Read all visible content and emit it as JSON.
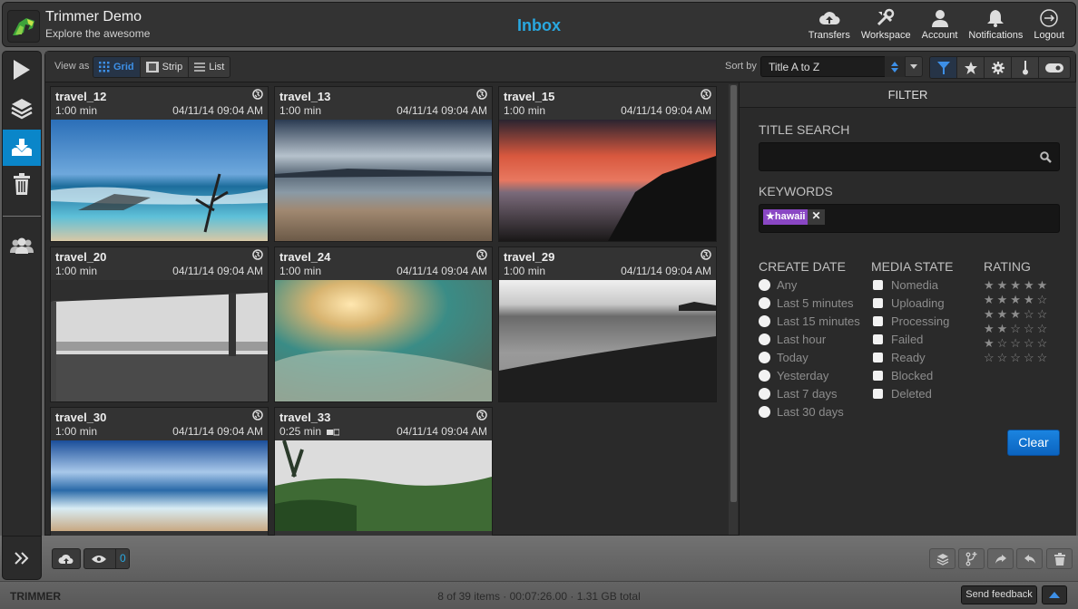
{
  "header": {
    "app_title": "Trimmer Demo",
    "app_subtitle": "Explore the awesome",
    "page_title": "Inbox",
    "nav": [
      {
        "label": "Transfers",
        "icon": "cloud-upload-icon"
      },
      {
        "label": "Workspace",
        "icon": "tools-icon"
      },
      {
        "label": "Account",
        "icon": "user-icon"
      },
      {
        "label": "Notifications",
        "icon": "bell-icon"
      },
      {
        "label": "Logout",
        "icon": "logout-icon"
      }
    ]
  },
  "sidebar": {
    "items": [
      {
        "name": "play",
        "icon": "play-icon",
        "active": false
      },
      {
        "name": "layers",
        "icon": "layers-icon",
        "active": false
      },
      {
        "name": "inbox",
        "icon": "inbox-download-icon",
        "active": true
      },
      {
        "name": "trash",
        "icon": "trash-icon",
        "active": false
      },
      {
        "name": "users",
        "icon": "users-icon",
        "active": false
      }
    ],
    "expand_icon": "double-chevron-right-icon"
  },
  "toolbar": {
    "view_as_label": "View as",
    "views": [
      {
        "label": "Grid",
        "icon": "grid-icon",
        "active": true
      },
      {
        "label": "Strip",
        "icon": "filmstrip-icon",
        "active": false
      },
      {
        "label": "List",
        "icon": "list-icon",
        "active": false
      }
    ],
    "sort_label": "Sort by",
    "sort_value": "Title A to Z",
    "tools": [
      {
        "icon": "filter-icon",
        "active": true
      },
      {
        "icon": "star-icon",
        "active": false
      },
      {
        "icon": "gear-icon",
        "active": false
      },
      {
        "icon": "thermometer-icon",
        "active": false
      },
      {
        "icon": "toggle-icon",
        "active": false
      }
    ]
  },
  "items": [
    {
      "title": "travel_12",
      "duration": "1:00 min",
      "date": "04/11/14 09:04 AM",
      "has_camera": false
    },
    {
      "title": "travel_13",
      "duration": "1:00 min",
      "date": "04/11/14 09:04 AM",
      "has_camera": false
    },
    {
      "title": "travel_15",
      "duration": "1:00 min",
      "date": "04/11/14 09:04 AM",
      "has_camera": false
    },
    {
      "title": "travel_20",
      "duration": "1:00 min",
      "date": "04/11/14 09:04 AM",
      "has_camera": false
    },
    {
      "title": "travel_24",
      "duration": "1:00 min",
      "date": "04/11/14 09:04 AM",
      "has_camera": false
    },
    {
      "title": "travel_29",
      "duration": "1:00 min",
      "date": "04/11/14 09:04 AM",
      "has_camera": false
    },
    {
      "title": "travel_30",
      "duration": "1:00 min",
      "date": "04/11/14 09:04 AM",
      "has_camera": false
    },
    {
      "title": "travel_33",
      "duration": "0:25 min",
      "date": "04/11/14 09:04 AM",
      "has_camera": true
    }
  ],
  "filter": {
    "title": "FILTER",
    "title_search_label": "TITLE SEARCH",
    "title_search_value": "",
    "keywords_label": "KEYWORDS",
    "keywords": [
      "★hawaii"
    ],
    "create_date_label": "CREATE DATE",
    "create_date_options": [
      "Any",
      "Last 5 minutes",
      "Last 15 minutes",
      "Last hour",
      "Today",
      "Yesterday",
      "Last 7 days",
      "Last 30 days"
    ],
    "media_state_label": "MEDIA STATE",
    "media_state_options": [
      "Nomedia",
      "Uploading",
      "Processing",
      "Failed",
      "Ready",
      "Blocked",
      "Deleted"
    ],
    "rating_label": "RATING",
    "rating_options": [
      "★★★★★",
      "★★★★☆",
      "★★★☆☆",
      "★★☆☆☆",
      "★☆☆☆☆",
      "☆☆☆☆☆"
    ],
    "clear_label": "Clear"
  },
  "bottom": {
    "upload_icon": "cloud-upload-icon",
    "watch_icon": "eye-icon",
    "watch_count": "0",
    "actions": [
      "layers-icon",
      "branch-add-icon",
      "forward-icon",
      "reply-icon",
      "trash-icon"
    ]
  },
  "status": {
    "brand": "TRIMMER",
    "summary": "8 of 39 items · 00:07:26.00 · 1.31 GB total",
    "feedback_label": "Send feedback"
  },
  "colors": {
    "accent": "#0a86c9",
    "title_blue": "#29a8e0",
    "keyword_tag": "#8a47c4",
    "clear_button": "#1278d4"
  }
}
